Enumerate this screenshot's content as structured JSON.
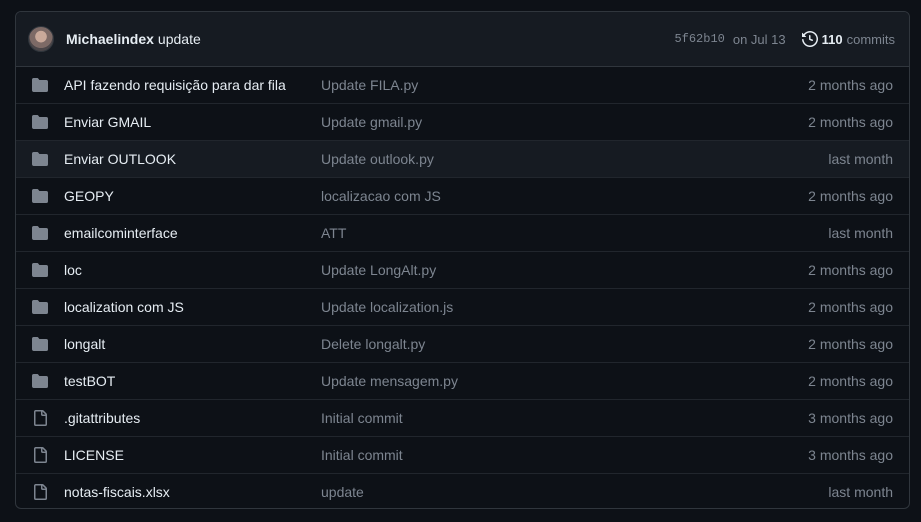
{
  "commit": {
    "author": "Michaelindex",
    "message": "update",
    "sha": "5f62b10",
    "date": "on Jul 13",
    "commit_count": "110",
    "commits_label": "commits"
  },
  "colors": {
    "background": "#0d1117",
    "header_bg": "#161b22",
    "border": "#30363d",
    "text": "#e6edf3",
    "muted": "#7d8590",
    "folder_icon": "#7d8590"
  },
  "files": [
    {
      "type": "folder",
      "icon": "folder-icon",
      "name": "API fazendo requisição para dar fila",
      "message": "Update FILA.py",
      "age": "2 months ago"
    },
    {
      "type": "folder",
      "icon": "folder-icon",
      "name": "Enviar GMAIL",
      "message": "Update gmail.py",
      "age": "2 months ago"
    },
    {
      "type": "folder",
      "icon": "folder-icon",
      "name": "Enviar OUTLOOK",
      "message": "Update outlook.py",
      "age": "last month"
    },
    {
      "type": "folder",
      "icon": "folder-icon",
      "name": "GEOPY",
      "message": "localizacao com JS",
      "age": "2 months ago"
    },
    {
      "type": "folder",
      "icon": "folder-icon",
      "name": "emailcominterface",
      "message": "ATT",
      "age": "last month"
    },
    {
      "type": "folder",
      "icon": "folder-icon",
      "name": "loc",
      "message": "Update LongAlt.py",
      "age": "2 months ago"
    },
    {
      "type": "folder",
      "icon": "folder-icon",
      "name": "localization com JS",
      "message": "Update localization.js",
      "age": "2 months ago"
    },
    {
      "type": "folder",
      "icon": "folder-icon",
      "name": "longalt",
      "message": "Delete longalt.py",
      "age": "2 months ago"
    },
    {
      "type": "folder",
      "icon": "folder-icon",
      "name": "testBOT",
      "message": "Update mensagem.py",
      "age": "2 months ago"
    },
    {
      "type": "file",
      "icon": "file-icon",
      "name": ".gitattributes",
      "message": "Initial commit",
      "age": "3 months ago"
    },
    {
      "type": "file",
      "icon": "file-icon",
      "name": "LICENSE",
      "message": "Initial commit",
      "age": "3 months ago"
    },
    {
      "type": "file",
      "icon": "file-icon",
      "name": "notas-fiscais.xlsx",
      "message": "update",
      "age": "last month"
    }
  ]
}
